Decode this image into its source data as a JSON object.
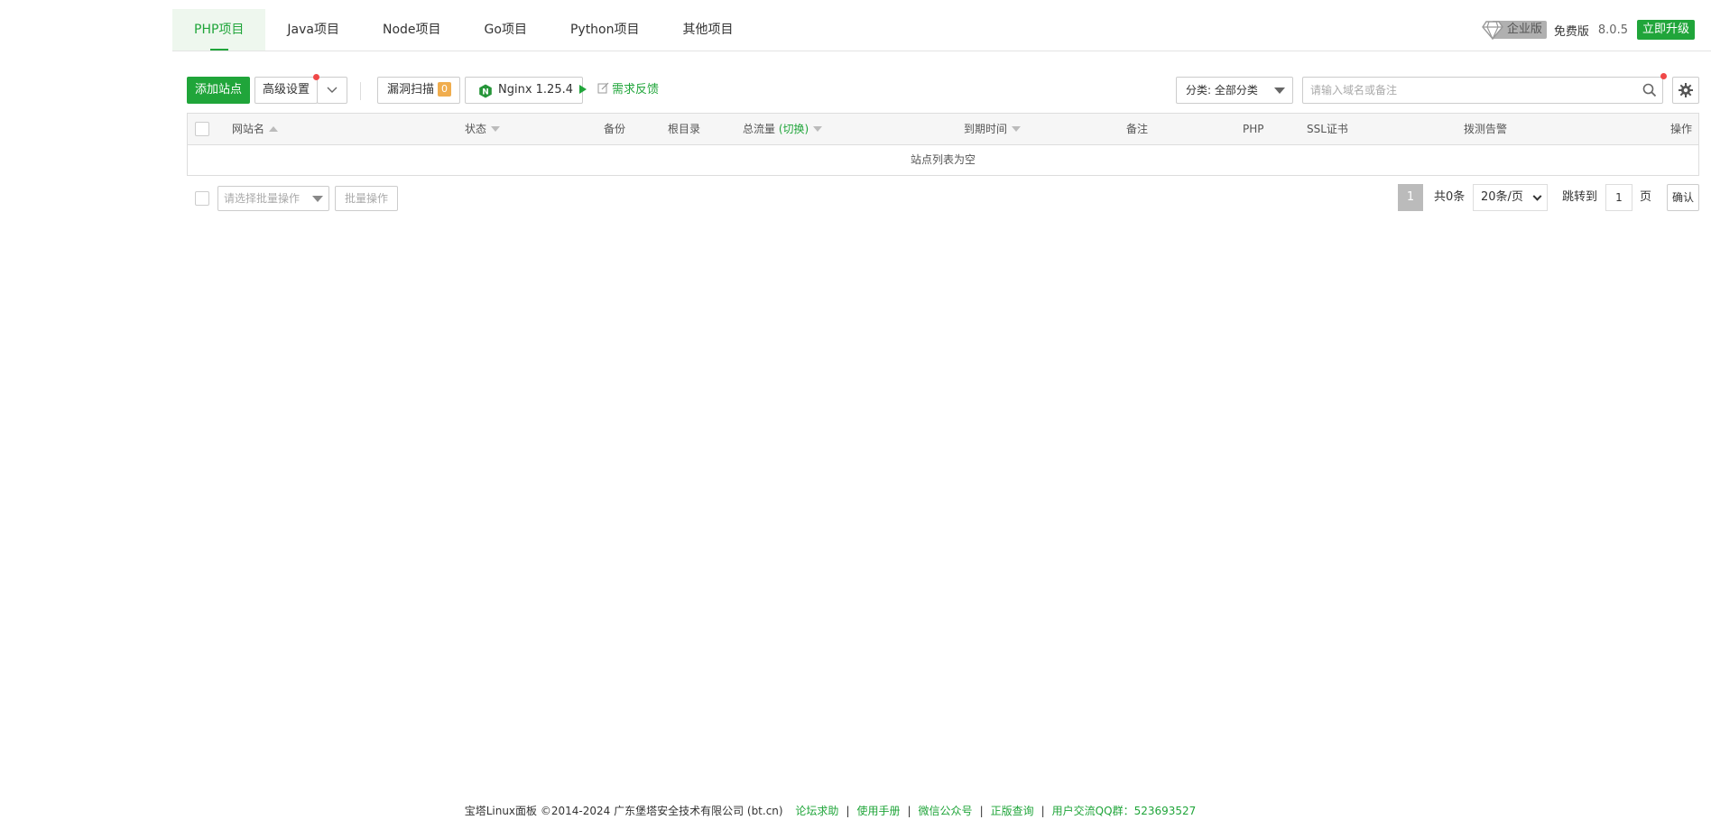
{
  "tabs": [
    "PHP项目",
    "Java项目",
    "Node项目",
    "Go项目",
    "Python项目",
    "其他项目"
  ],
  "header": {
    "enterprise_label": "企业版",
    "free_label": "免费版",
    "version": "8.0.5",
    "upgrade_label": "立即升级"
  },
  "toolbar": {
    "add_site": "添加站点",
    "advanced_settings": "高级设置",
    "vuln_scan": "漏洞扫描",
    "vuln_count": "0",
    "nginx_label": "Nginx 1.25.4",
    "feedback": "需求反馈",
    "category": "分类: 全部分类",
    "search_placeholder": "请输入域名或备注"
  },
  "table": {
    "headers": {
      "site_name": "网站名",
      "status": "状态",
      "backup": "备份",
      "root_dir": "根目录",
      "total_traffic": "总流量",
      "switch": "(切换)",
      "expire": "到期时间",
      "remark": "备注",
      "php": "PHP",
      "ssl": "SSL证书",
      "probe": "拨测告警",
      "actions": "操作"
    },
    "empty_text": "站点列表为空"
  },
  "bottom": {
    "batch_placeholder": "请选择批量操作",
    "batch_button": "批量操作",
    "current_page": "1",
    "total": "共0条",
    "per_page": "20条/页",
    "jump_label": "跳转到",
    "jump_value": "1",
    "page_unit": "页",
    "confirm": "确认"
  },
  "footer": {
    "copyright": "宝塔Linux面板 ©2014-2024 广东堡塔安全技术有限公司 (bt.cn)",
    "links": [
      "论坛求助",
      "使用手册",
      "微信公众号",
      "正版查询",
      "用户交流QQ群：523693527"
    ]
  },
  "colors": {
    "accent": "#20a53a",
    "warning": "#f0ad4e",
    "dot": "#f04848"
  }
}
